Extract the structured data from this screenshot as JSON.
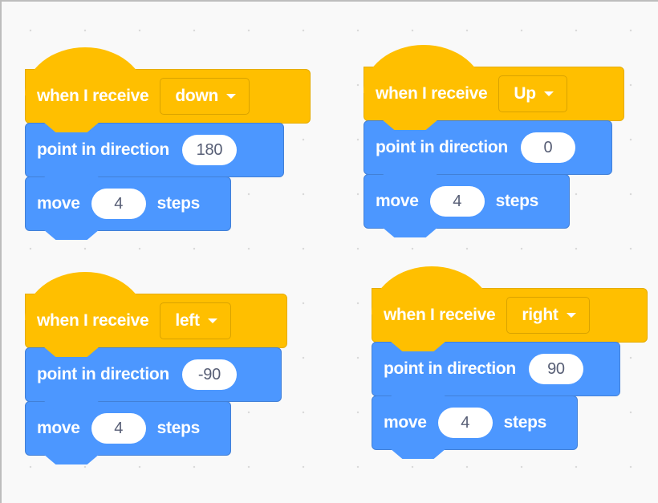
{
  "workspace": {
    "background_color": "#f9f9f9",
    "event_color": "#ffbf00",
    "motion_color": "#4c97ff"
  },
  "scripts": [
    {
      "hat": {
        "label": "when I receive",
        "message": "down"
      },
      "point": {
        "label": "point in direction",
        "value": "180"
      },
      "move": {
        "label": "move",
        "value": "4",
        "suffix": "steps"
      }
    },
    {
      "hat": {
        "label": "when I receive",
        "message": "Up"
      },
      "point": {
        "label": "point in direction",
        "value": "0"
      },
      "move": {
        "label": "move",
        "value": "4",
        "suffix": "steps"
      }
    },
    {
      "hat": {
        "label": "when I receive",
        "message": "left"
      },
      "point": {
        "label": "point in direction",
        "value": "-90"
      },
      "move": {
        "label": "move",
        "value": "4",
        "suffix": "steps"
      }
    },
    {
      "hat": {
        "label": "when I receive",
        "message": "right"
      },
      "point": {
        "label": "point in direction",
        "value": "90"
      },
      "move": {
        "label": "move",
        "value": "4",
        "suffix": "steps"
      }
    }
  ]
}
